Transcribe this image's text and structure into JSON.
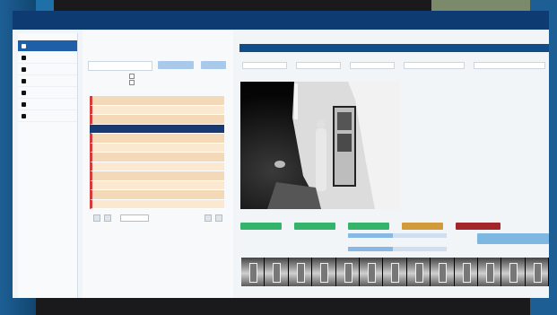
{
  "app": {
    "title": "",
    "menu": [
      "",
      ""
    ],
    "user": [
      "",
      ""
    ]
  },
  "nav": {
    "heading": "",
    "items": [
      {
        "label": "",
        "active": true
      },
      {
        "label": "",
        "active": false
      },
      {
        "label": "",
        "active": false
      },
      {
        "label": "",
        "active": false
      },
      {
        "label": "",
        "active": false
      },
      {
        "label": "",
        "active": false
      },
      {
        "label": "",
        "active": false
      }
    ]
  },
  "left_panel": {
    "title": "",
    "filter_input": "",
    "buttons": [
      "",
      ""
    ],
    "checkboxes": [
      "",
      ""
    ],
    "columns": [
      "",
      "",
      ""
    ],
    "rows": [
      {
        "id": "",
        "camera": "",
        "time": "",
        "selected": false
      },
      {
        "id": "",
        "camera": "",
        "time": "",
        "selected": false
      },
      {
        "id": "",
        "camera": "",
        "time": "",
        "selected": false
      },
      {
        "id": "",
        "camera": "",
        "time": "",
        "selected": true
      },
      {
        "id": "",
        "camera": "",
        "time": "",
        "selected": false
      },
      {
        "id": "",
        "camera": "",
        "time": "",
        "selected": false
      },
      {
        "id": "",
        "camera": "",
        "time": "",
        "selected": false
      },
      {
        "id": "",
        "camera": "",
        "time": "",
        "selected": false
      },
      {
        "id": "",
        "camera": "",
        "time": "",
        "selected": false
      },
      {
        "id": "",
        "camera": "",
        "time": "",
        "selected": false
      },
      {
        "id": "",
        "camera": "",
        "time": "",
        "selected": false
      },
      {
        "id": "",
        "camera": "",
        "time": "",
        "selected": false
      }
    ],
    "pager": {
      "select": ""
    }
  },
  "right_panel": {
    "bar_title": "",
    "fields": [
      {
        "label": "",
        "value": ""
      },
      {
        "label": "",
        "value": ""
      },
      {
        "label": "",
        "value": ""
      },
      {
        "label": "",
        "value": ""
      },
      {
        "label": "",
        "value": ""
      }
    ],
    "actions": [
      {
        "label": "",
        "color": "#34b36a"
      },
      {
        "label": "",
        "color": "#34b36a"
      },
      {
        "label": "",
        "color": "#34b36a"
      },
      {
        "label": "",
        "color": "#d19a3a"
      },
      {
        "label": "",
        "color": "#a3262b"
      }
    ],
    "sliders": [
      {
        "label": "",
        "value": "",
        "level": 0.45
      },
      {
        "label": "",
        "value": "",
        "level": 0.45
      }
    ],
    "big_button": ""
  },
  "colors": {
    "topbar": "#0f3b73",
    "selected_row": "#173a75",
    "row_fill": "#f3d9b8",
    "row_marker": "#d43c3c",
    "green": "#34b36a",
    "orange": "#d19a3a",
    "red": "#a3262b"
  }
}
